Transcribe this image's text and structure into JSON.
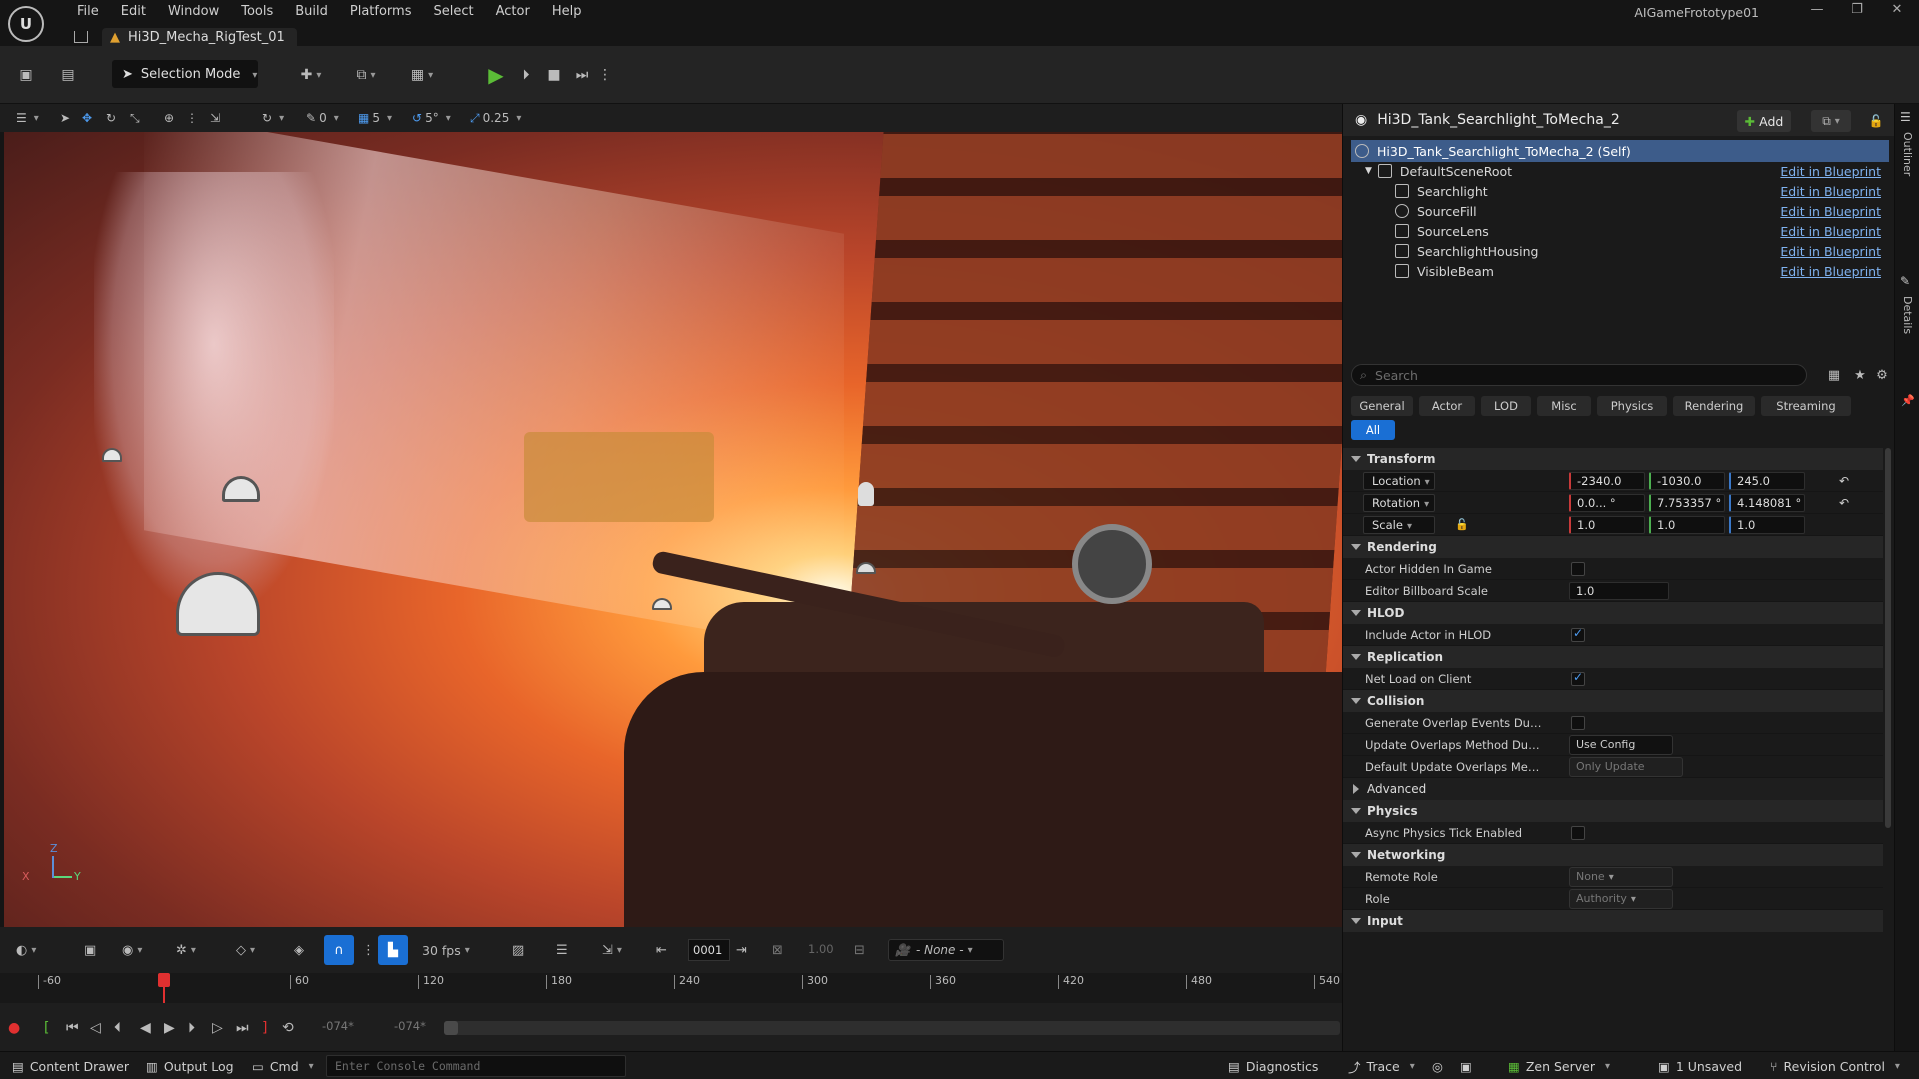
{
  "menu": {
    "items": [
      "File",
      "Edit",
      "Window",
      "Tools",
      "Build",
      "Platforms",
      "Select",
      "Actor",
      "Help"
    ]
  },
  "document_tab": {
    "label": "Hi3D_Mecha_RigTest_01"
  },
  "project": {
    "name": "AIGameFrototype01"
  },
  "toolbar": {
    "selection_mode": "Selection Mode"
  },
  "viewport_toolbar": {
    "rotate_snap_value": "0",
    "grid_snap": "5",
    "angle_snap": "5°",
    "scale_snap": "0.25"
  },
  "outliner": {
    "title": "Hi3D_Tank_Searchlight_ToMecha_2",
    "add_label": "Add",
    "self_row": "Hi3D_Tank_Searchlight_ToMecha_2 (Self)",
    "edit_label": "Edit in Blueprint",
    "components": [
      {
        "label": "DefaultSceneRoot",
        "icon": "scene-root-icon"
      },
      {
        "label": "Searchlight",
        "icon": "spotlight-icon"
      },
      {
        "label": "SourceFill",
        "icon": "point-light-icon"
      },
      {
        "label": "SourceLens",
        "icon": "static-mesh-icon"
      },
      {
        "label": "SearchlightHousing",
        "icon": "static-mesh-icon"
      },
      {
        "label": "VisibleBeam",
        "icon": "static-mesh-icon"
      }
    ]
  },
  "details": {
    "search_placeholder": "Search",
    "filters": [
      "General",
      "Actor",
      "LOD",
      "Misc",
      "Physics",
      "Rendering",
      "Streaming"
    ],
    "filter_all": "All",
    "sections": {
      "transform": "Transform",
      "rendering": "Rendering",
      "hlod": "HLOD",
      "replication": "Replication",
      "collision": "Collision",
      "physics": "Physics",
      "networking": "Networking",
      "input": "Input"
    },
    "transform": {
      "location_label": "Location",
      "location": [
        "-2340.0",
        "-1030.0",
        "245.0"
      ],
      "rotation_label": "Rotation",
      "rotation": [
        "0.0... °",
        "7.753357 °",
        "4.148081 °"
      ],
      "scale_label": "Scale",
      "scale": [
        "1.0",
        "1.0",
        "1.0"
      ]
    },
    "rendering": {
      "hidden_label": "Actor Hidden In Game",
      "hidden": false,
      "billboard_label": "Editor Billboard Scale",
      "billboard": "1.0"
    },
    "hlod": {
      "include_label": "Include Actor in HLOD",
      "include": true
    },
    "replication": {
      "net_load_label": "Net Load on Client",
      "net_load": true
    },
    "collision": {
      "overlap_label": "Generate Overlap Events During Lev...",
      "overlap": false,
      "update_label": "Update Overlaps Method During Lev...",
      "update_value": "Use Config Default",
      "default_label": "Default Update Overlaps Method Du...",
      "default_value": "Only Update Movable",
      "advanced_label": "Advanced"
    },
    "physics": {
      "async_label": "Async Physics Tick Enabled",
      "async": false
    },
    "networking": {
      "remote_role_label": "Remote Role",
      "remote_role": "None",
      "role_label": "Role",
      "role": "Authority"
    }
  },
  "sidebar": {
    "outliner": "Outliner",
    "details": "Details"
  },
  "timeline": {
    "fps": "30 fps",
    "frame": "0001",
    "rate": "1.00",
    "camera": "- None -",
    "ticks": [
      "-60",
      "60",
      "120",
      "180",
      "240",
      "300",
      "360",
      "420",
      "480",
      "540"
    ],
    "start": "-074*",
    "end": "-074*"
  },
  "statusbar": {
    "content_drawer": "Content Drawer",
    "output_log": "Output Log",
    "cmd": "Cmd",
    "console_placeholder": "Enter Console Command",
    "diagnostics": "Diagnostics",
    "trace": "Trace",
    "zen_server": "Zen Server",
    "unsaved": "1 Unsaved",
    "revision_control": "Revision Control"
  },
  "gizmo": {
    "x": "X",
    "y": "Y",
    "z": "Z"
  },
  "colors": {
    "accent": "#1a6fd4",
    "play": "#5bbc37",
    "link": "#7fb2f0",
    "selected_row": "#3d5c8a"
  }
}
